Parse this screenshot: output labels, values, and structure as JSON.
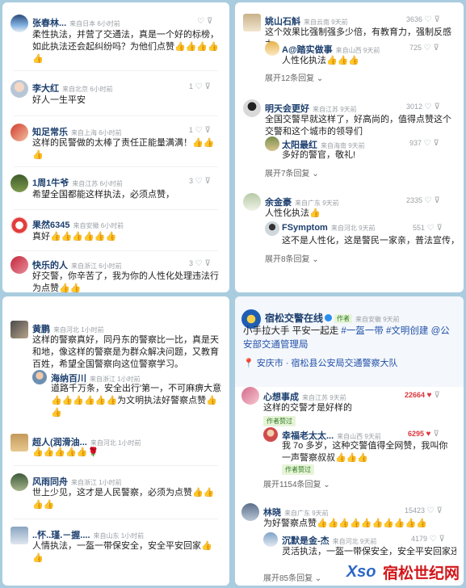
{
  "panel1": {
    "comments": [
      {
        "user": "张春林...",
        "meta": "来自日本 6小时前",
        "text": "柔性执法，并营了交通法，真是一个好的标榜，如此执法还会起纠纷吗？为他们点赞👍👍👍👍👍",
        "likes": ""
      },
      {
        "user": "李大红",
        "meta": "来自北京 6小时前",
        "text": "好人一生平安",
        "likes": "1"
      },
      {
        "user": "知足常乐",
        "meta": "来自上海 6小时前",
        "text": "这样的民警做的太棒了责任正能量满满！👍👍👍",
        "likes": "1"
      },
      {
        "user": "1周1牛爷",
        "meta": "来自江苏 6小时前",
        "text": "希望全国都能这样执法，必须点赞，",
        "likes": "3"
      },
      {
        "user": "果然6345",
        "meta": "来自安徽 6小时前",
        "text": "真好👍👍👍👍👍👍",
        "likes": ""
      },
      {
        "user": "快乐的人",
        "meta": "来自浙江 6小时前",
        "text": "好交警，你辛苦了，我为你的人性化处理违法行为点赞👍👍",
        "likes": "3"
      }
    ]
  },
  "panel2": {
    "comments": [
      {
        "user": "姚山石斛",
        "meta": "来自云南 9天前",
        "text": "这个效果比强制强多少倍，有教育力，强制反感力",
        "likes": "3636",
        "reply": {
          "user": "A@踏实做事",
          "meta": "来自山西 9天前",
          "text": "人性化执法👍👍👍",
          "likes": "725"
        },
        "more": "展开12条回复"
      },
      {
        "user": "明天会更好",
        "meta": "来自江苏 9天前",
        "text": "全国交警早就这样了，好高尚的，值得点赞这个交警和这个城市的领导们",
        "likes": "3012",
        "reply": {
          "user": "太阳最红",
          "meta": "来自海南 9天前",
          "text": "多好的警官，敬礼!",
          "likes": "937"
        },
        "more": "展开7条回复"
      },
      {
        "user": "余金豪",
        "meta": "来自广东 9天前",
        "text": "人性化执法👍",
        "likes": "2335",
        "reply": {
          "user": "FSymptom",
          "meta": "来自河北 9天前",
          "text": "这不是人性化，这是警民一家亲，普法宣传，",
          "likes": "551"
        },
        "more": "展开8条回复"
      }
    ]
  },
  "panel3": {
    "comments": [
      {
        "user": "黄鹏",
        "meta": "来自河北 1小时前",
        "text": "这样的警察真好，同丹东的警察比一比，真是天和地，像这样的警察是为群众解决问题，又教育百姓，希望全国警察向这位警察学习。",
        "likes": ""
      },
      {
        "user": "海纳百川",
        "meta": "来自浙江 1小时前",
        "text": "道路千万条，安全出行'第一，不可麻痹大意👍👍👍👍👍👍为文明执法好警察点赞👍👍",
        "likes": ""
      },
      {
        "user": "超人(润滑油...",
        "meta": "来自河北 1小时前",
        "text": "👍👍👍👍👍🌹",
        "likes": ""
      },
      {
        "user": "风雨同舟",
        "meta": "来自浙江 1小时前",
        "text": "世上少见，这才是人民警察，必须为点赞👍👍👍👍",
        "likes": ""
      },
      {
        "user": "..怀..瑾.－握....",
        "meta": "来自山东 1小时前",
        "text": "人情执法，一盔一带保安全，安全平安回家👍👍",
        "likes": ""
      }
    ]
  },
  "panel4": {
    "post": {
      "user": "宿松交警在线",
      "author_tag": "作者",
      "meta": "来自安徽 9天前",
      "text_plain": "小手拉大手  平安一起走 ",
      "topics": "#一盔一带 #文明创建 @公安部交通管理局",
      "location": "安庆市 · 宿松县公安局交通警察大队"
    },
    "comments": [
      {
        "user": "心想事成",
        "meta": "来自江苏 9天前",
        "text": "这样的交警才是好样的",
        "likes": "22664",
        "badge": "作者赞过",
        "reply": {
          "user": "幸福老太太...",
          "meta": "来自山西 9天前",
          "text": "我 7o 多岁，这种交警值得全网赞，我叫你一声警察叔叔👍👍👍",
          "likes": "6295",
          "badge": "作者赞过"
        },
        "more": "展开1154条回复"
      },
      {
        "user": "林晓",
        "meta": "来自广东 9天前",
        "text": "为好警察点赞👍👍👍👍👍👍👍👍👍👍",
        "likes": "15423",
        "reply": {
          "user": "沉默是金-杰",
          "meta": "来自河北 9天前",
          "text": "灵活执法，一盔一带保安全，安全平安回家还",
          "likes": "4179"
        },
        "more": "展开85条回复"
      }
    ]
  },
  "watermark": {
    "logo": "Xso",
    "text": "宿松世纪网"
  },
  "colors": {
    "background": "#a9ccdf",
    "name": "#1c3f6e",
    "hot": "#d9363e",
    "link": "#1f4fa8"
  }
}
